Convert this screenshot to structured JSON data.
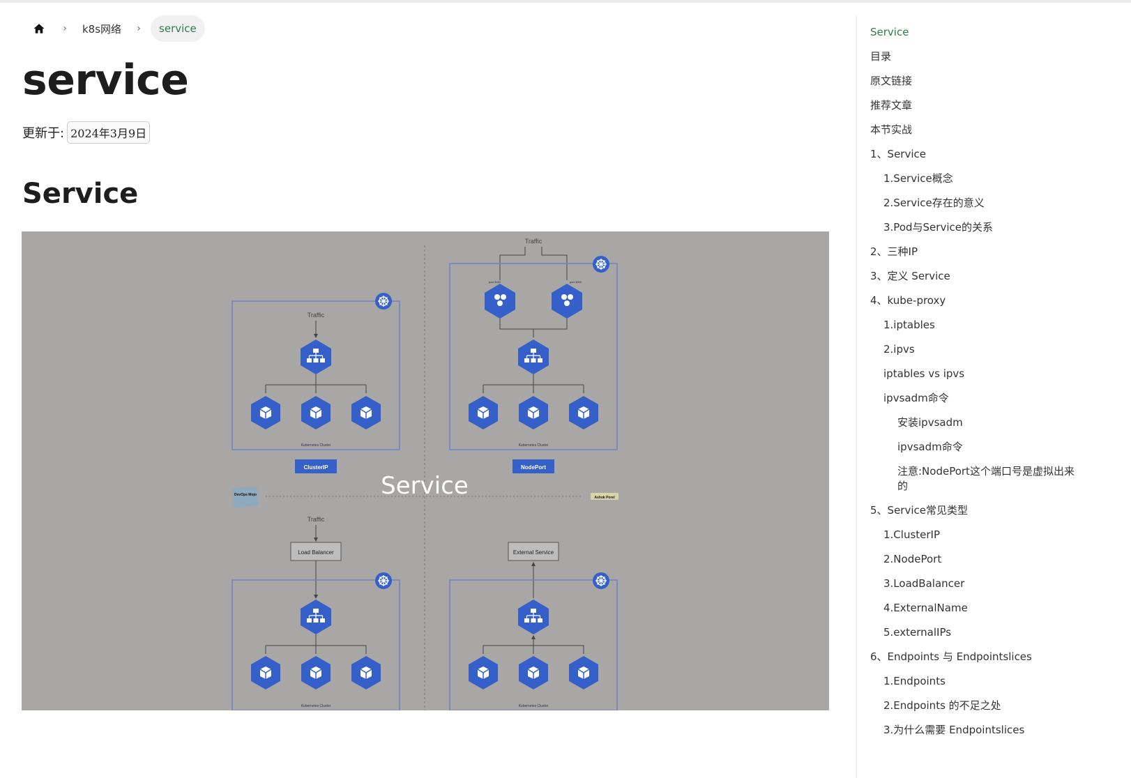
{
  "breadcrumb": {
    "home_icon": "home-icon",
    "separator": "›",
    "items": [
      "k8s网络"
    ],
    "current": "service"
  },
  "page": {
    "title": "service",
    "updated_label": "更新于:",
    "updated_date": "2024年3月9日",
    "section_heading": "Service"
  },
  "diagram": {
    "center_label": "Service",
    "top_traffic": "Traffic",
    "cluster_caption": "Kubernetes Cluster",
    "clusterip_label": "ClusterIP",
    "nodeport_label": "NodePort",
    "loadbalancer_box": "Load Balancer",
    "external_box": "External Service",
    "svc_label": "svc",
    "pod_label": "pod",
    "node_label": "node",
    "port_label": "port 3000",
    "badge_left": "DevOps Mojo",
    "badge_right": "Ashok Porel",
    "colors": {
      "hex": "#3560c9",
      "bg": "#a9a7a6",
      "box": "#6a86c0"
    }
  },
  "toc": {
    "items": [
      {
        "label": "Service",
        "level": 1,
        "active": true
      },
      {
        "label": "目录",
        "level": 1
      },
      {
        "label": "原文链接",
        "level": 1
      },
      {
        "label": "推荐文章",
        "level": 1
      },
      {
        "label": "本节实战",
        "level": 1
      },
      {
        "label": "1、Service",
        "level": 1
      },
      {
        "label": "1.Service概念",
        "level": 2
      },
      {
        "label": "2.Service存在的意义",
        "level": 2
      },
      {
        "label": "3.Pod与Service的关系",
        "level": 2
      },
      {
        "label": "2、三种IP",
        "level": 1
      },
      {
        "label": "3、定义 Service",
        "level": 1
      },
      {
        "label": "4、kube-proxy",
        "level": 1
      },
      {
        "label": "1.iptables",
        "level": 2
      },
      {
        "label": "2.ipvs",
        "level": 2
      },
      {
        "label": "iptables vs ipvs",
        "level": 2
      },
      {
        "label": "ipvsadm命令",
        "level": 2
      },
      {
        "label": "安装ipvsadm",
        "level": 3
      },
      {
        "label": "ipvsadm命令",
        "level": 3
      },
      {
        "label": "注意:NodePort这个端口号是虚拟出来的",
        "level": 3
      },
      {
        "label": "5、Service常见类型",
        "level": 1
      },
      {
        "label": "1.ClusterIP",
        "level": 2
      },
      {
        "label": "2.NodePort",
        "level": 2
      },
      {
        "label": "3.LoadBalancer",
        "level": 2
      },
      {
        "label": "4.ExternalName",
        "level": 2
      },
      {
        "label": "5.externalIPs",
        "level": 2
      },
      {
        "label": "6、Endpoints 与 Endpointslices",
        "level": 1
      },
      {
        "label": "1.Endpoints",
        "level": 2
      },
      {
        "label": "2.Endpoints 的不足之处",
        "level": 2
      },
      {
        "label": "3.为什么需要 Endpointslices",
        "level": 2
      }
    ]
  }
}
